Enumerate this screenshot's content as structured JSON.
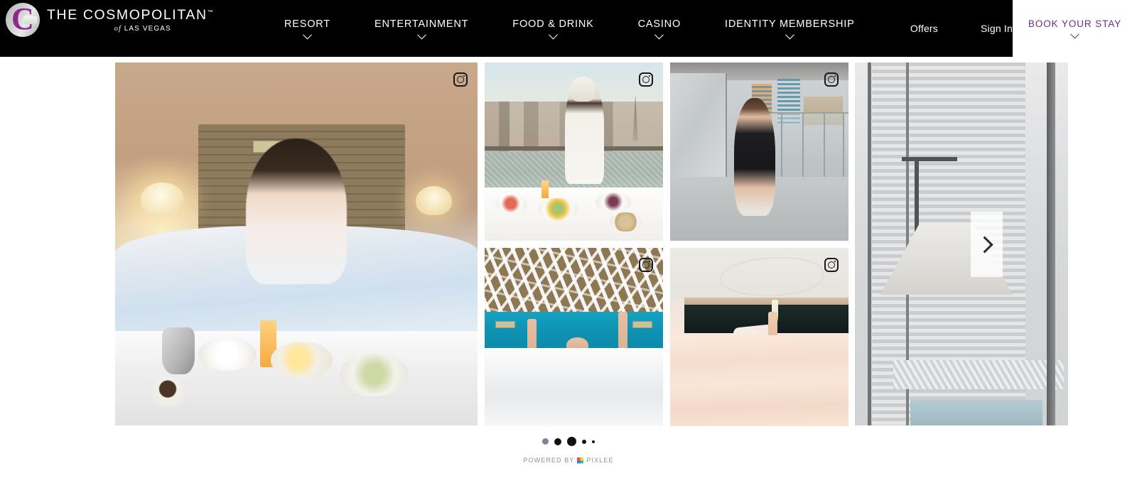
{
  "header": {
    "logo": {
      "mark_icon": "cosmopolitan-c-icon",
      "title": "THE COSMOPOLITAN",
      "trademark": "™",
      "subtitle_prefix": "of",
      "subtitle": "LAS VEGAS"
    },
    "nav": [
      {
        "label": "RESORT",
        "has_dropdown": true
      },
      {
        "label": "ENTERTAINMENT",
        "has_dropdown": true
      },
      {
        "label": "FOOD & DRINK",
        "has_dropdown": true
      },
      {
        "label": "CASINO",
        "has_dropdown": true
      },
      {
        "label": "IDENTITY MEMBERSHIP",
        "has_dropdown": true
      }
    ],
    "offers_label": "Offers",
    "signin_label": "Sign In",
    "book_label": "BOOK YOUR STAY",
    "book_has_dropdown": true,
    "colors": {
      "background": "#000000",
      "text": "#ffffff",
      "brand_purple": "#6b2d8e",
      "book_background": "#ffffff"
    }
  },
  "gallery": {
    "source_icon": "instagram-icon",
    "next_arrow_icon": "chevron-right-icon",
    "tiles": [
      {
        "id": "tile-1",
        "alt": "Woman in robe having breakfast in bed in hotel room",
        "size": "large"
      },
      {
        "id": "tile-2",
        "alt": "Woman in towel and robe with breakfast spread on balcony overlooking Las Vegas Strip",
        "size": "small"
      },
      {
        "id": "tile-3",
        "alt": "Woman in black slip dress walking on high-rise balcony",
        "size": "small"
      },
      {
        "id": "tile-4",
        "alt": "Hands making heart shape in bed with graffiti wall and teal headboard",
        "size": "small"
      },
      {
        "id": "tile-5",
        "alt": "Person toasting champagne glasses in bed with blush bedding",
        "size": "small"
      },
      {
        "id": "tile-6",
        "alt": "Lamp beside floor-to-ceiling window with city view",
        "size": "tall"
      }
    ]
  },
  "footer": {
    "dots": [
      {
        "state": "visited",
        "size": 9,
        "color": "#7b8694"
      },
      {
        "state": "inactive",
        "size": 10,
        "color": "#111111"
      },
      {
        "state": "active",
        "size": 13,
        "color": "#111111"
      },
      {
        "state": "inactive",
        "size": 6,
        "color": "#111111"
      },
      {
        "state": "inactive",
        "size": 4,
        "color": "#111111"
      }
    ],
    "powered_by_label": "POWERED BY",
    "powered_by_brand": "PIXLEE",
    "powered_by_icon": "pixlee-logo-icon"
  }
}
